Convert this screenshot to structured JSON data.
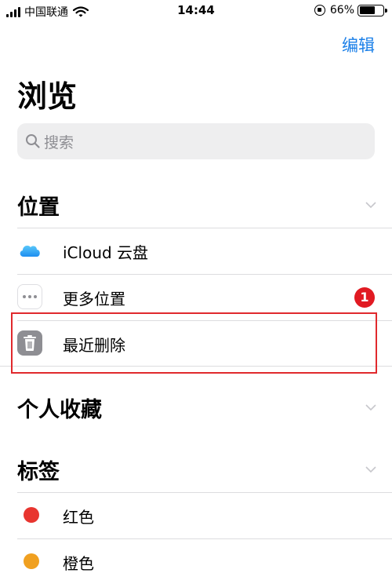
{
  "status_bar": {
    "carrier": "中国联通",
    "time": "14:44",
    "battery_percent": "66%",
    "battery_level": 0.66
  },
  "header": {
    "edit_label": "编辑",
    "title": "浏览"
  },
  "search": {
    "placeholder": "搜索"
  },
  "sections": {
    "locations": {
      "title": "位置",
      "items": [
        {
          "label": "iCloud 云盘",
          "icon": "cloud-icon"
        },
        {
          "label": "更多位置",
          "icon": "more-icon",
          "badge": "1"
        },
        {
          "label": "最近删除",
          "icon": "trash-icon",
          "highlighted": true
        }
      ]
    },
    "favorites": {
      "title": "个人收藏"
    },
    "tags": {
      "title": "标签",
      "items": [
        {
          "label": "红色",
          "color": "#e8352f"
        },
        {
          "label": "橙色",
          "color": "#f0a020"
        }
      ]
    }
  },
  "colors": {
    "accent": "#1a7fe8",
    "badge": "#e11a22",
    "highlight_border": "#e0292d"
  }
}
